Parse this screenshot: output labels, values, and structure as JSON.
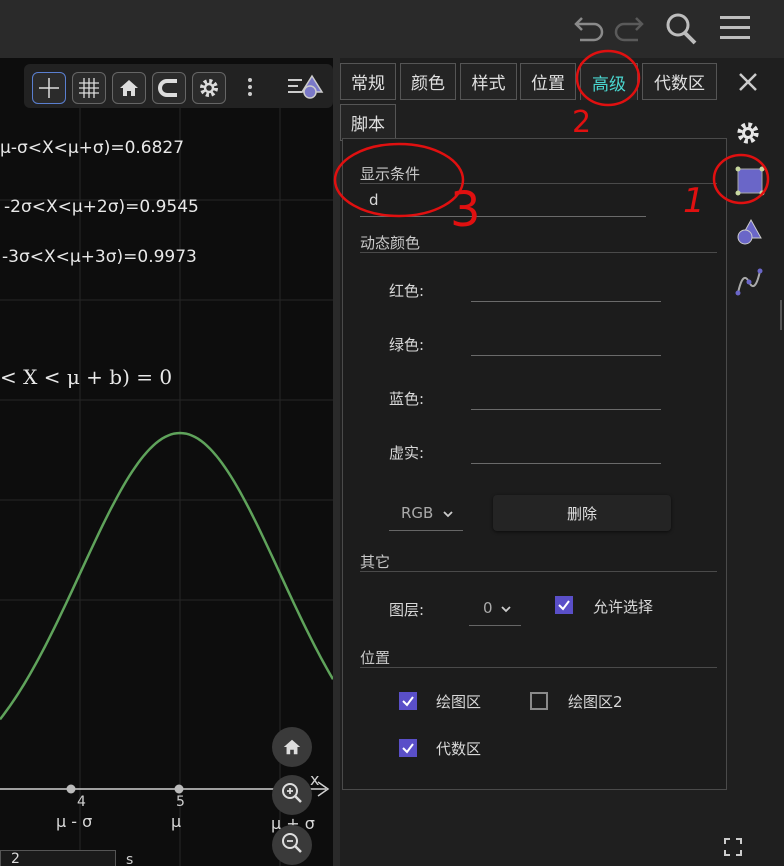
{
  "graphics": {
    "formulas": [
      "μ-σ<X<μ+σ)=0.6827",
      "-2σ<X<μ+2σ)=0.9545",
      "-3σ<X<μ+3σ)=0.9973"
    ],
    "big_formula": "< X < μ + b) = 0",
    "axis_x_label": "x",
    "tick_4": "4",
    "tick_5": "5",
    "tick_mu_minus_sigma": "μ - σ",
    "tick_mu": "μ",
    "tick_mu_plus_sigma": "μ + σ",
    "bottom_input_value": "2",
    "bottom_label": "s",
    "curve_color": "#5fa35b"
  },
  "tabs": [
    "常规",
    "颜色",
    "样式",
    "位置",
    "高级",
    "代数区",
    "脚本"
  ],
  "active_tab": "高级",
  "advanced": {
    "show_condition_label": "显示条件",
    "show_condition_value": "d",
    "dynamic_color_label": "动态颜色",
    "red_label": "红色:",
    "green_label": "绿色:",
    "blue_label": "蓝色:",
    "opacity_label": "虚实:",
    "color_model": "RGB",
    "delete_label": "删除",
    "other_label": "其它",
    "layer_label": "图层:",
    "layer_value": "0",
    "allow_select_label": "允许选择",
    "allow_select_checked": true,
    "position_label": "位置",
    "graphics_label": "绘图区",
    "graphics_checked": true,
    "graphics2_label": "绘图区2",
    "graphics2_checked": false,
    "algebra_label": "代数区",
    "algebra_checked": true
  },
  "annotations": [
    "1",
    "2",
    "3"
  ],
  "colors": {
    "accent": "#4ad6cf",
    "checkbox": "#5a4fc8",
    "annotation": "#e01010"
  },
  "icons": [
    "undo-icon",
    "redo-icon",
    "search-icon",
    "menu-icon",
    "axes-icon",
    "grid-icon",
    "home-icon",
    "magnet-icon",
    "gear-icon",
    "more-icon",
    "style-bar-icon",
    "close-icon",
    "basic-object-icon",
    "shapes-icon",
    "function-icon",
    "zoom-in-icon",
    "zoom-out-icon",
    "fullscreen-icon"
  ]
}
